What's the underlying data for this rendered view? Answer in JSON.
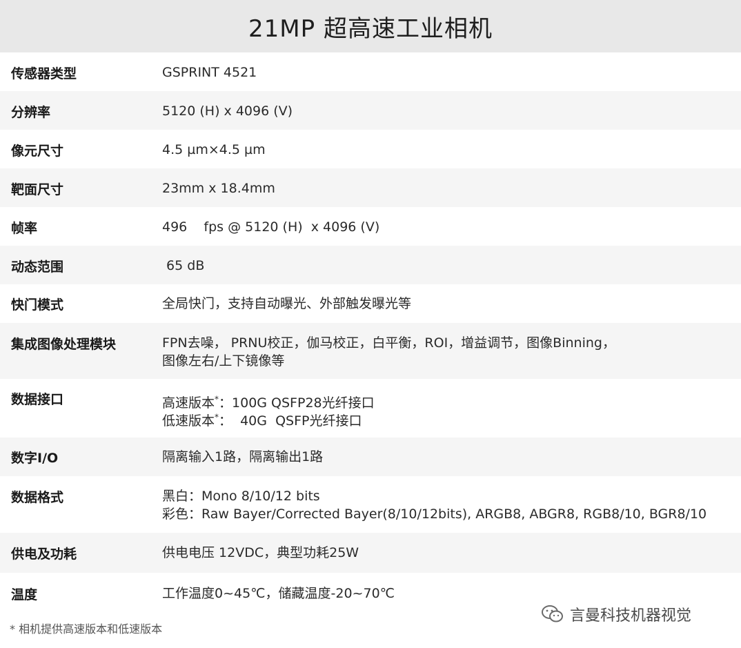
{
  "title": "21MP 超高速工业相机",
  "rows": [
    {
      "label": "传感器类型",
      "lines": [
        "GSPRINT 4521"
      ]
    },
    {
      "label": "分辨率",
      "lines": [
        "5120 (H) x 4096 (V)"
      ]
    },
    {
      "label": "像元尺寸",
      "lines": [
        "4.5 µm×4.5 µm"
      ]
    },
    {
      "label": "靶面尺寸",
      "lines": [
        "23mm x 18.4mm"
      ]
    },
    {
      "label": "帧率",
      "lines": [
        "496    fps @ 5120 (H)  x 4096 (V)"
      ]
    },
    {
      "label": "动态范围",
      "lines": [
        " 65 dB"
      ]
    },
    {
      "label": "快门模式",
      "lines": [
        "全局快门，支持自动曝光、外部触发曝光等"
      ]
    },
    {
      "label": "集成图像处理模块",
      "lines": [
        "FPN去噪， PRNU校正，伽马校正，白平衡，ROI，增益调节，图像Binning，",
        "图像左右/上下镜像等"
      ]
    },
    {
      "label": "数据接口",
      "lines": [
        "高速版本",
        "低速版本"
      ],
      "line_sup": [
        "*",
        "*"
      ],
      "line_rest": [
        "：100G QSFP28光纤接口",
        "：  40G  QSFP光纤接口"
      ]
    },
    {
      "label": "数字I/O",
      "lines": [
        "隔离输入1路，隔离输出1路"
      ]
    },
    {
      "label": "数据格式",
      "lines": [
        "黑白：Mono 8/10/12 bits",
        "彩色：Raw Bayer/Corrected Bayer(8/10/12bits), ARGB8, ABGR8, RGB8/10, BGR8/10"
      ]
    },
    {
      "label": "供电及功耗",
      "lines": [
        "供电电压 12VDC，典型功耗25W"
      ]
    },
    {
      "label": "温度",
      "lines": [
        "工作温度0~45℃，储藏温度-20~70℃"
      ]
    }
  ],
  "footnote": "* 相机提供高速版本和低速版本",
  "watermark": {
    "text": "言曼科技机器视觉",
    "icon": "wechat-icon"
  },
  "colors": {
    "title_bg": "#e8e8e8",
    "row_alt_bg": "#f5f5f5",
    "row_bg": "#ffffff"
  }
}
